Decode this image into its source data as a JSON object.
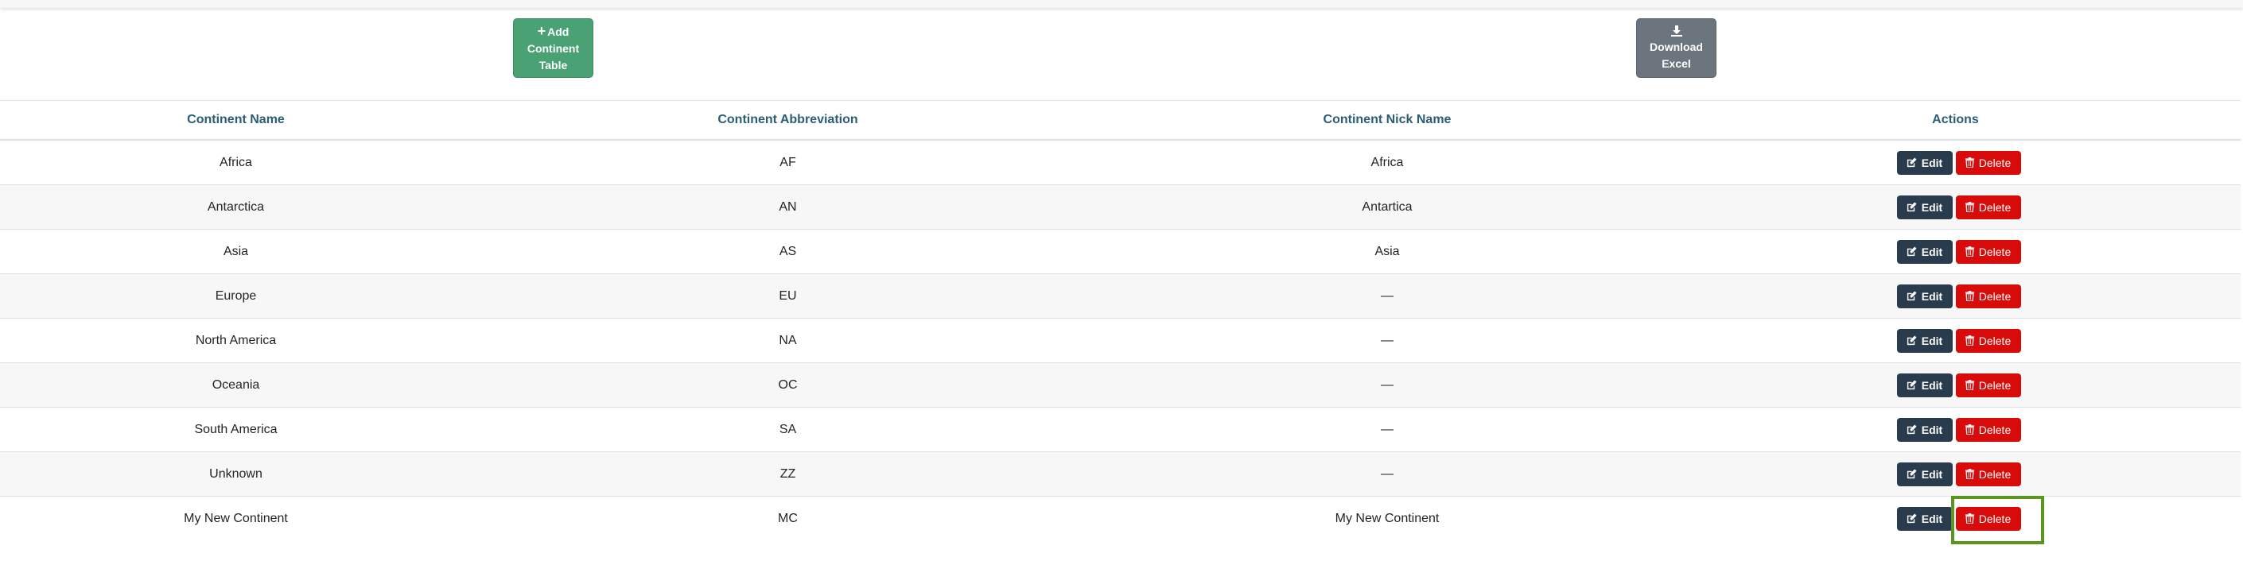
{
  "toolbar": {
    "add_icon": "+",
    "add_label_1": "Add",
    "add_label_2": "Continent",
    "add_label_3": "Table",
    "download_icon": "download-icon",
    "download_label_1": "Download",
    "download_label_2": "Excel"
  },
  "table": {
    "headers": [
      "Continent Name",
      "Continent Abbreviation",
      "Continent Nick Name",
      "Actions"
    ],
    "edit_label": "Edit",
    "delete_label": "Delete",
    "rows": [
      {
        "name": "Africa",
        "abbr": "AF",
        "nick": "Africa"
      },
      {
        "name": "Antarctica",
        "abbr": "AN",
        "nick": "Antartica"
      },
      {
        "name": "Asia",
        "abbr": "AS",
        "nick": "Asia"
      },
      {
        "name": "Europe",
        "abbr": "EU",
        "nick": "—"
      },
      {
        "name": "North America",
        "abbr": "NA",
        "nick": "—"
      },
      {
        "name": "Oceania",
        "abbr": "OC",
        "nick": "—"
      },
      {
        "name": "South America",
        "abbr": "SA",
        "nick": "—"
      },
      {
        "name": "Unknown",
        "abbr": "ZZ",
        "nick": "—"
      },
      {
        "name": "My New Continent",
        "abbr": "MC",
        "nick": "My New Continent"
      }
    ]
  },
  "colors": {
    "add_button": "#4aa274",
    "download_button": "#6c757d",
    "edit_button": "#2b3b4e",
    "delete_button": "#d80b0b",
    "header_text": "#2b5d74",
    "highlight": "#5a9520"
  }
}
